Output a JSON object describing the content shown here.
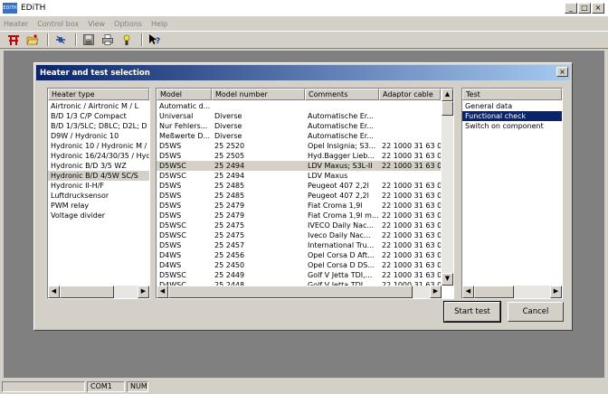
{
  "app": {
    "title": "EDiTH",
    "logo_text": "EDiTH"
  },
  "menu": [
    "Heater",
    "Control box",
    "View",
    "Options",
    "Help"
  ],
  "toolbar_icons": [
    "connect-icon",
    "open-folder-icon",
    "disconnect-icon",
    "save-icon",
    "print-icon",
    "info-icon",
    "context-help-icon"
  ],
  "window_controls": {
    "minimize": "_",
    "maximize": "□",
    "close": "×"
  },
  "dialog": {
    "title": "Heater and test selection",
    "close": "×",
    "heater_type": {
      "header": "Heater type",
      "items": [
        "Airtronic / Airtronic M / L",
        "B/D 1/3 C/P Compact",
        "B/D 1/3/5LC; D8LC; D2L; D",
        "D9W / Hydronic 10",
        "Hydronic 10 / Hydronic M / M",
        "Hydronic 16/24/30/35 / Hyd",
        "Hydronic B/D 3/5 WZ",
        "Hydronic B/D 4/5W SC/S",
        "Hydronic II-H/F",
        "Luftdrucksensor",
        "PWM relay",
        "Voltage divider"
      ],
      "selected_index": 7
    },
    "models": {
      "headers": [
        "Model",
        "Model number",
        "Comments",
        "Adaptor cable"
      ],
      "rows": [
        [
          "Automatic d...",
          "",
          "",
          ""
        ],
        [
          "Universal",
          "Diverse",
          "Automatische Er...",
          ""
        ],
        [
          "Nur Fehlers...",
          "Diverse",
          "Automatische Er...",
          ""
        ],
        [
          "Meßwerte D...",
          "Diverse",
          "Automatische Er...",
          ""
        ],
        [
          "D5WS",
          "25 2520",
          "Opel Insignia; S3...",
          "22 1000 31 63 00"
        ],
        [
          "D5WS",
          "25 2505",
          "Hyd.Bagger Lieb...",
          "22 1000 31 63 00"
        ],
        [
          "D5WSC",
          "25 2494",
          "LDV Maxus; S3L-II",
          "22 1000 31 63 00"
        ],
        [
          "D5WSC",
          "25 2494",
          "LDV Maxus",
          ""
        ],
        [
          "D5WS",
          "25 2485",
          "Peugeot 407 2,2l",
          "22 1000 31 63 00"
        ],
        [
          "D5WS",
          "25 2485",
          "Peugeot 407 2,2l",
          "22 1000 31 63 00"
        ],
        [
          "D5WS",
          "25 2479",
          "Fiat Croma 1,9l",
          "22 1000 31 63 00"
        ],
        [
          "D5WS",
          "25 2479",
          "Fiat Croma 1,9l m...",
          "22 1000 31 63 00"
        ],
        [
          "D5WSC",
          "25 2475",
          "IVECO Daily Nac...",
          "22 1000 31 63 00"
        ],
        [
          "D5WSC",
          "25 2475",
          "Iveco Daily Nac...",
          "22 1000 31 63 00"
        ],
        [
          "D5WS",
          "25 2457",
          "International Tru...",
          "22 1000 31 63 00"
        ],
        [
          "D4WS",
          "25 2456",
          "Opel Corsa D Aft...",
          "22 1000 31 63 00"
        ],
        [
          "D4WS",
          "25 2450",
          "Opel Corsa D DS...",
          "22 1000 31 63 00"
        ],
        [
          "D5WSC",
          "25 2449",
          "Golf V Jetta TDI,...",
          "22 1000 31 63 00"
        ],
        [
          "D4WSC",
          "25 2448",
          "Golf V Jetta TDI,...",
          "22 1000 31 63 00"
        ]
      ],
      "selected_index": 6
    },
    "tests": {
      "header": "Test",
      "items": [
        "General data",
        "Functional check",
        "Switch on component"
      ],
      "selected_index": 1
    },
    "buttons": {
      "start": "Start test",
      "cancel": "Cancel"
    }
  },
  "status": {
    "port": "COM1",
    "numlock": "NUM"
  },
  "scroll_arrows": {
    "left": "◀",
    "right": "▶",
    "up": "▲",
    "down": "▼"
  }
}
